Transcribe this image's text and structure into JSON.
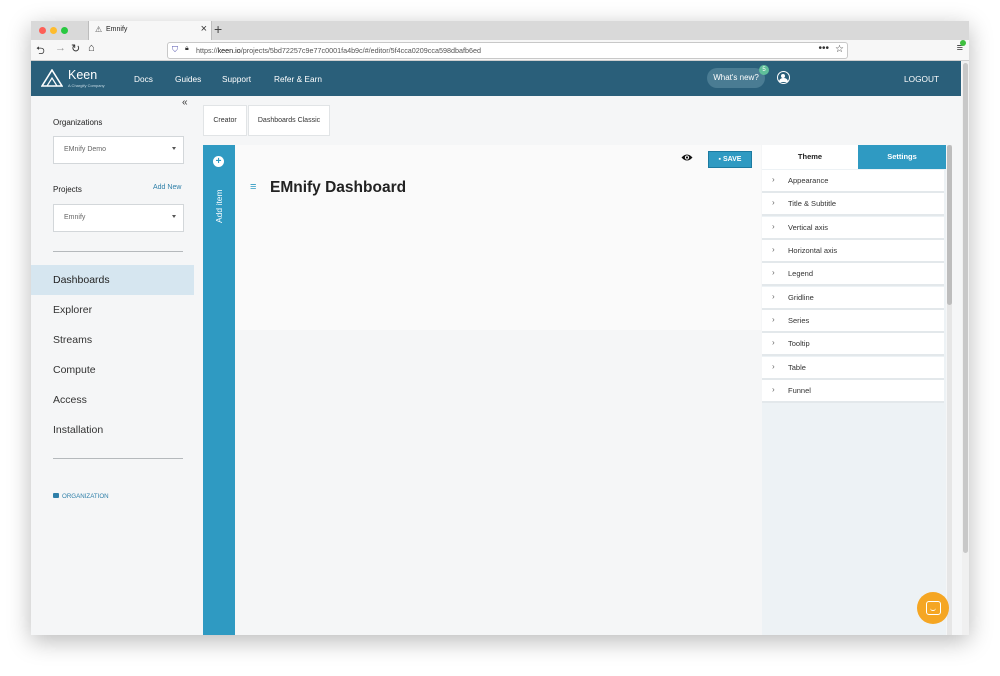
{
  "browser": {
    "tab_title": "Emnify",
    "url_prefix": "https://",
    "url_host": "keen.io",
    "url_path": "/projects/5bd72257c9e77c0001fa4b9c/#/editor/5f4cca0209cca598dbafb6ed"
  },
  "header": {
    "logo_name": "Keen",
    "logo_sub": "A Chargify Company",
    "nav": [
      "Docs",
      "Guides",
      "Support",
      "Refer & Earn"
    ],
    "whats_new": "What's new?",
    "whats_new_count": "5",
    "logout": "LOGOUT"
  },
  "sidebar": {
    "organizations_label": "Organizations",
    "organization_value": "EMnify Demo",
    "projects_label": "Projects",
    "add_new": "Add New",
    "project_value": "Emnify",
    "nav": [
      "Dashboards",
      "Explorer",
      "Streams",
      "Compute",
      "Access",
      "Installation"
    ],
    "active": "Dashboards",
    "org_link": "ORGANIZATION"
  },
  "main": {
    "tabs": [
      "Creator",
      "Dashboards Classic"
    ],
    "add_item": "Add item",
    "save": "SAVE",
    "dashboard_title": "EMnify Dashboard"
  },
  "panel": {
    "tab_theme": "Theme",
    "tab_settings": "Settings",
    "items": [
      "Appearance",
      "Title & Subtitle",
      "Vertical axis",
      "Horizontal axis",
      "Legend",
      "Gridline",
      "Series",
      "Tooltip",
      "Table",
      "Funnel"
    ]
  },
  "colors": {
    "header": "#2a5f7a",
    "accent": "#2f9ac2",
    "active_nav": "#d6e6f0",
    "chat": "#f5a623"
  }
}
